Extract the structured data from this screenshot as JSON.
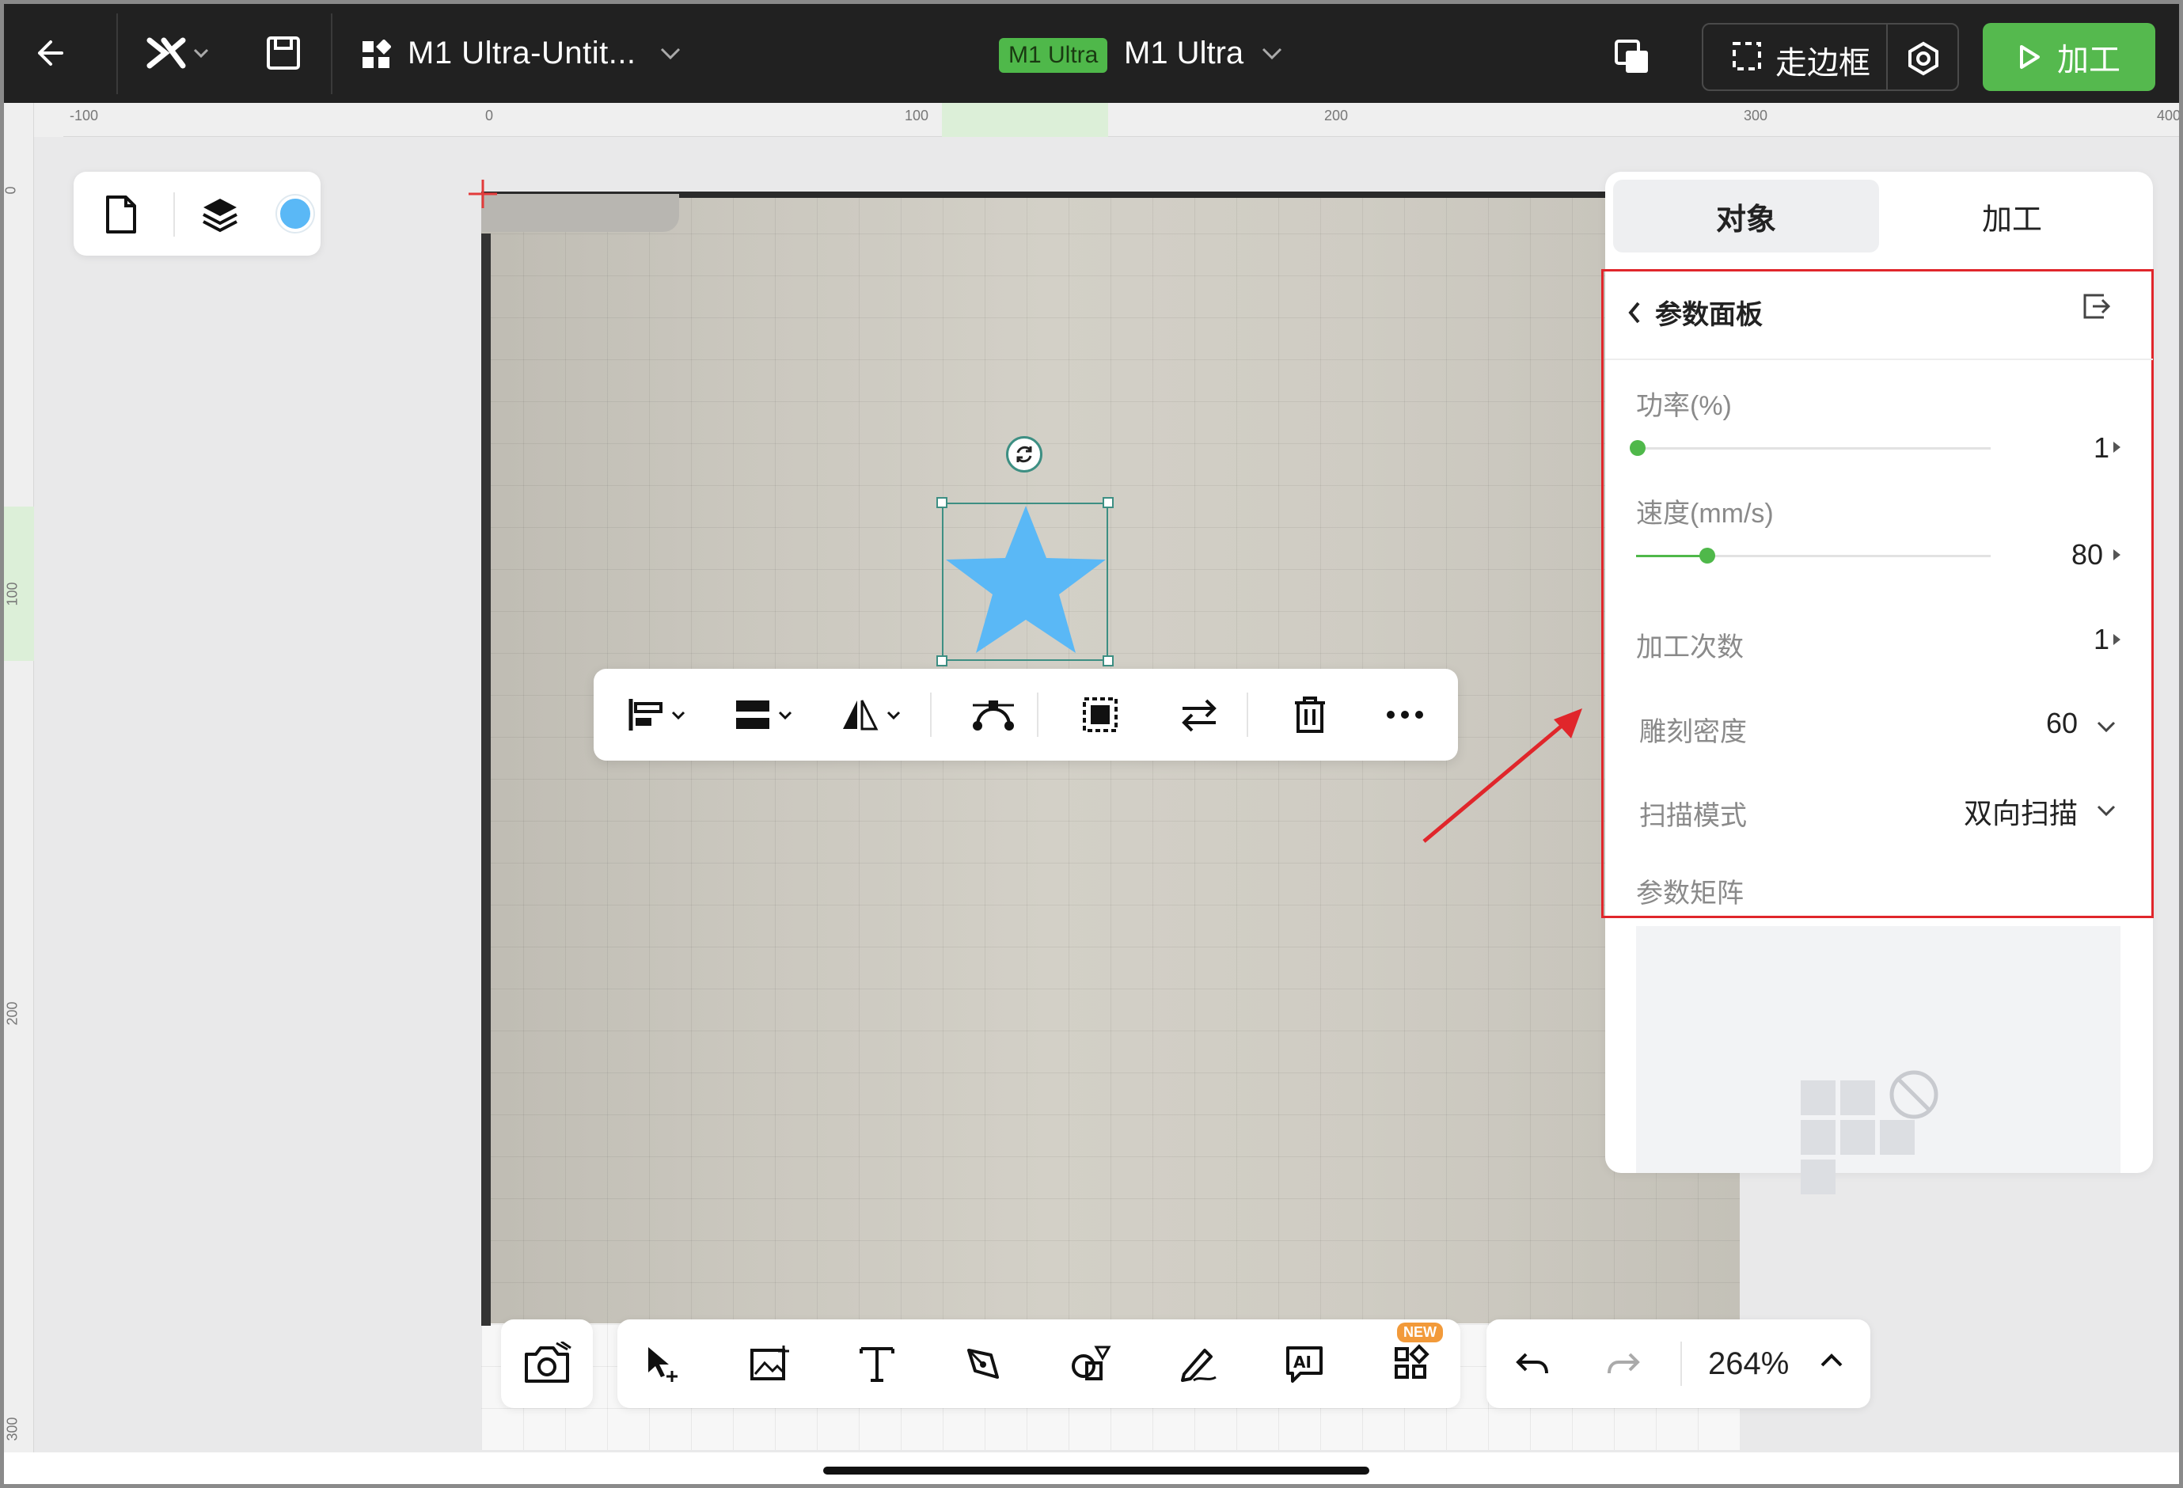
{
  "topbar": {
    "doc_title": "M1 Ultra-Untit...",
    "device_badge": "M1 Ultra",
    "device_name": "M1 Ultra",
    "frame_label": "走边框",
    "process_label": "加工"
  },
  "rulers": {
    "top": [
      "-100",
      "0",
      "100",
      "200",
      "300",
      "400"
    ],
    "left": [
      "0",
      "100",
      "200",
      "300"
    ]
  },
  "right_panel": {
    "tabs": [
      {
        "label": "对象",
        "active": true
      },
      {
        "label": "加工",
        "active": false
      }
    ],
    "header": "参数面板",
    "power": {
      "label": "功率(%)",
      "value": "1",
      "fraction": 0.0
    },
    "speed": {
      "label": "速度(mm/s)",
      "value": "80",
      "fraction": 0.2
    },
    "passes": {
      "label": "加工次数",
      "value": "1"
    },
    "density": {
      "label": "雕刻密度",
      "value": "60"
    },
    "scan_mode": {
      "label": "扫描模式",
      "value": "双向扫描"
    },
    "matrix_label": "参数矩阵"
  },
  "bottom": {
    "new_badge": "NEW",
    "zoom": "264%"
  },
  "colors": {
    "accent": "#4fb84a",
    "shape_fill": "#5ab8f6",
    "highlight": "#e0262b",
    "topbar_bg": "#212121"
  }
}
